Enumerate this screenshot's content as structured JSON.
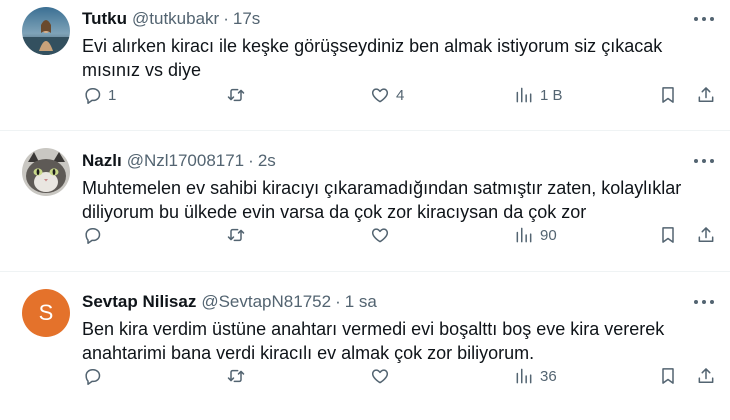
{
  "tweets": [
    {
      "name": "Tutku",
      "handle": "@tutkubakr",
      "time": "17s",
      "text": "Evi alırken kiracı ile keşke görüşseydiniz ben almak istiyorum siz çıkacak mısınız vs diye",
      "replies": "1",
      "retweets": "",
      "likes": "4",
      "views": "1 B",
      "avatar": "photo"
    },
    {
      "name": "Nazlı",
      "handle": "@Nzl17008171",
      "time": "2s",
      "text": "Muhtemelen ev sahibi kiracıyı çıkaramadığından satmıştır zaten, kolaylıklar diliyorum bu ülkede evin varsa da çok zor kiracıysan da çok zor",
      "replies": "",
      "retweets": "",
      "likes": "",
      "views": "90",
      "avatar": "cat-photo"
    },
    {
      "name": "Sevtap Nilisaz",
      "handle": "@SevtapN81752",
      "time": "1 sa",
      "text": "Ben kira verdim üstüne anahtarı vermedi evi boşalttı boş eve kira vererek anahtarimi bana verdi kiracılı ev almak çok zor biliyorum.",
      "replies": "",
      "retweets": "",
      "likes": "",
      "views": "36",
      "avatar_letter": "S",
      "avatar_color": "#e4722b"
    }
  ],
  "separator": "·",
  "colors": {
    "text": "#0f1419",
    "secondary": "#536471",
    "border": "#eff3f4"
  },
  "icons": [
    "more-icon",
    "reply-icon",
    "retweet-icon",
    "like-icon",
    "views-icon",
    "bookmark-icon",
    "share-icon"
  ]
}
